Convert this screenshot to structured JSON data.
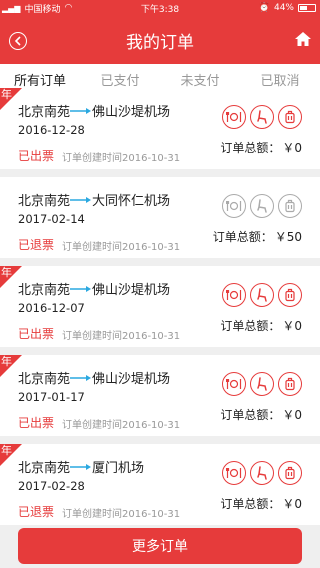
{
  "status_bar": {
    "carrier": "中国移动",
    "time": "下午3:38",
    "battery": "44%"
  },
  "header": {
    "title": "我的订单",
    "back_icon": "chevron-left-icon",
    "home_icon": "home-icon"
  },
  "tabs": [
    {
      "label": "所有订单",
      "active": true
    },
    {
      "label": "已支付",
      "active": false
    },
    {
      "label": "未支付",
      "active": false
    },
    {
      "label": "已取消",
      "active": false
    }
  ],
  "orders": [
    {
      "corner": "年",
      "from": "北京南苑",
      "to": "佛山沙堤机场",
      "date": "2016-12-28",
      "status": "已出票",
      "created_label": "订单创建时间",
      "created_date": "2016-10-31",
      "total_label": "订单总额：",
      "total": "￥0",
      "icons_active": true
    },
    {
      "corner": "",
      "from": "北京南苑",
      "to": "大同怀仁机场",
      "date": "2017-02-14",
      "status": "已退票",
      "created_label": "订单创建时间",
      "created_date": "2016-10-31",
      "total_label": "订单总额：",
      "total": "￥50",
      "icons_active": false
    },
    {
      "corner": "年",
      "from": "北京南苑",
      "to": "佛山沙堤机场",
      "date": "2016-12-07",
      "status": "已出票",
      "created_label": "订单创建时间",
      "created_date": "2016-10-31",
      "total_label": "订单总额：",
      "total": "￥0",
      "icons_active": true
    },
    {
      "corner": "年",
      "from": "北京南苑",
      "to": "佛山沙堤机场",
      "date": "2017-01-17",
      "status": "已出票",
      "created_label": "订单创建时间",
      "created_date": "2016-10-31",
      "total_label": "订单总额：",
      "total": "￥0",
      "icons_active": true
    },
    {
      "corner": "年",
      "from": "北京南苑",
      "to": "厦门机场",
      "date": "2017-02-28",
      "status": "已退票",
      "created_label": "订单创建时间",
      "created_date": "2016-10-31",
      "total_label": "订单总额：",
      "total": "￥0",
      "icons_active": true
    }
  ],
  "more_button": "更多订单",
  "colors": {
    "accent": "#e63b3b",
    "arrow": "#2aa8e0"
  }
}
